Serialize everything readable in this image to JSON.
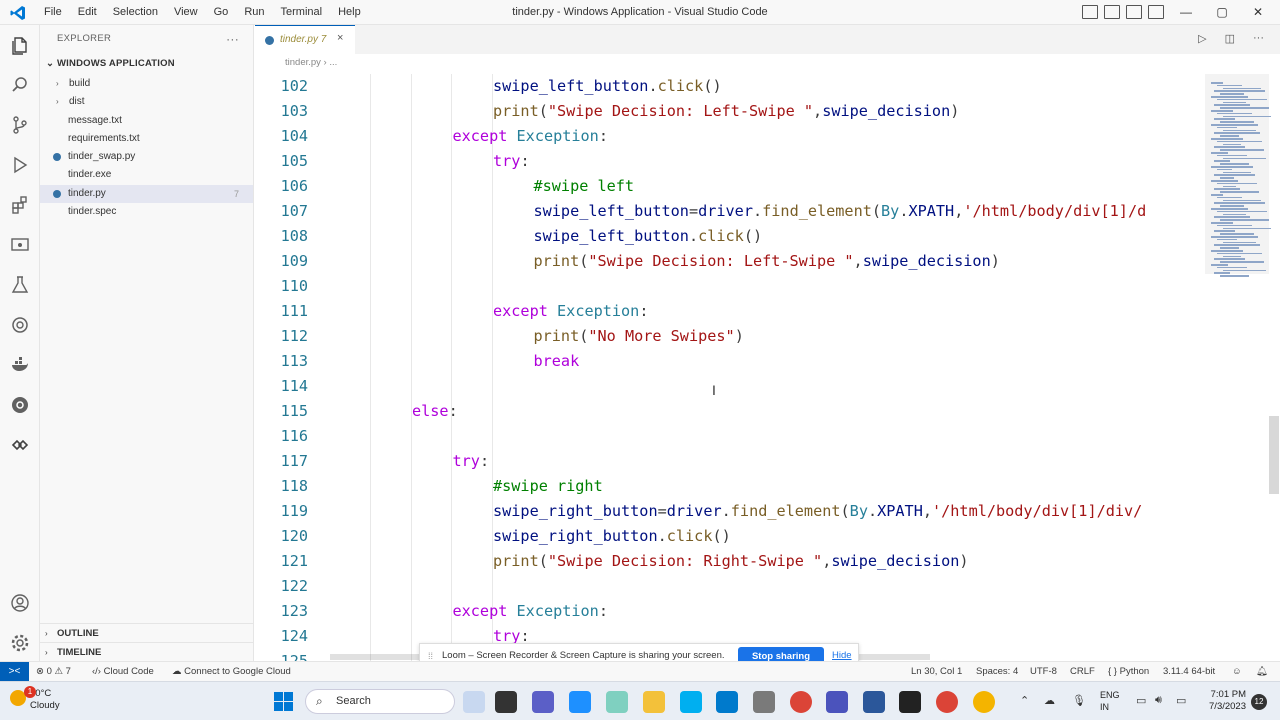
{
  "titlebar": {
    "menu": [
      "File",
      "Edit",
      "Selection",
      "View",
      "Go",
      "Run",
      "Terminal",
      "Help"
    ],
    "title": "tinder.py - Windows Application - Visual Studio Code",
    "controls": [
      "—",
      "▢",
      "✕"
    ]
  },
  "explorer": {
    "header": "EXPLORER",
    "more": "···",
    "project": "WINDOWS APPLICATION",
    "items": [
      {
        "label": "build",
        "type": "folder",
        "chev": "›"
      },
      {
        "label": "dist",
        "type": "folder",
        "chev": "›"
      },
      {
        "label": "message.txt",
        "type": "file"
      },
      {
        "label": "requirements.txt",
        "type": "file"
      },
      {
        "label": "tinder_swap.py",
        "type": "python"
      },
      {
        "label": "tinder.exe",
        "type": "file"
      },
      {
        "label": "tinder.py",
        "type": "python",
        "badge": "7",
        "selected": true
      },
      {
        "label": "tinder.spec",
        "type": "file"
      }
    ],
    "outline": "OUTLINE",
    "timeline": "TIMELINE",
    "chev": "›"
  },
  "tab": {
    "label": "tinder.py",
    "badge": "7",
    "close": "×"
  },
  "breadcrumb": "tinder.py  ›  ...",
  "editor": {
    "lines": [
      {
        "n": "102",
        "indent": 4,
        "tokens": [
          [
            "var",
            "swipe_left_button"
          ],
          [
            "p",
            "."
          ],
          [
            "fn",
            "click"
          ],
          [
            "p",
            "()"
          ]
        ]
      },
      {
        "n": "103",
        "indent": 4,
        "tokens": [
          [
            "fn",
            "print"
          ],
          [
            "p",
            "("
          ],
          [
            "str",
            "\"Swipe Decision: Left-Swipe \""
          ],
          [
            "p",
            ","
          ],
          [
            "var",
            "swipe_decision"
          ],
          [
            "p",
            ")"
          ]
        ]
      },
      {
        "n": "104",
        "indent": 3,
        "tokens": [
          [
            "kw",
            "except"
          ],
          [
            "p",
            " "
          ],
          [
            "cls",
            "Exception"
          ],
          [
            "p",
            ":"
          ]
        ]
      },
      {
        "n": "105",
        "indent": 4,
        "tokens": [
          [
            "kw",
            "try"
          ],
          [
            "p",
            ":"
          ]
        ]
      },
      {
        "n": "106",
        "indent": 5,
        "tokens": [
          [
            "cm",
            "#swipe left"
          ]
        ]
      },
      {
        "n": "107",
        "indent": 5,
        "tokens": [
          [
            "var",
            "swipe_left_button"
          ],
          [
            "p",
            "="
          ],
          [
            "var",
            "driver"
          ],
          [
            "p",
            "."
          ],
          [
            "fn",
            "find_element"
          ],
          [
            "p",
            "("
          ],
          [
            "cls",
            "By"
          ],
          [
            "p",
            "."
          ],
          [
            "var",
            "XPATH"
          ],
          [
            "p",
            ","
          ],
          [
            "str",
            "'/html/body/div[1]/d"
          ]
        ]
      },
      {
        "n": "108",
        "indent": 5,
        "tokens": [
          [
            "var",
            "swipe_left_button"
          ],
          [
            "p",
            "."
          ],
          [
            "fn",
            "click"
          ],
          [
            "p",
            "()"
          ]
        ]
      },
      {
        "n": "109",
        "indent": 5,
        "tokens": [
          [
            "fn",
            "print"
          ],
          [
            "p",
            "("
          ],
          [
            "str",
            "\"Swipe Decision: Left-Swipe \""
          ],
          [
            "p",
            ","
          ],
          [
            "var",
            "swipe_decision"
          ],
          [
            "p",
            ")"
          ]
        ]
      },
      {
        "n": "110",
        "indent": 0,
        "tokens": []
      },
      {
        "n": "111",
        "indent": 4,
        "tokens": [
          [
            "kw",
            "except"
          ],
          [
            "p",
            " "
          ],
          [
            "cls",
            "Exception"
          ],
          [
            "p",
            ":"
          ]
        ]
      },
      {
        "n": "112",
        "indent": 5,
        "tokens": [
          [
            "fn",
            "print"
          ],
          [
            "p",
            "("
          ],
          [
            "str",
            "\"No More Swipes\""
          ],
          [
            "p",
            ")"
          ]
        ]
      },
      {
        "n": "113",
        "indent": 5,
        "tokens": [
          [
            "kw",
            "break"
          ]
        ]
      },
      {
        "n": "114",
        "indent": 0,
        "tokens": []
      },
      {
        "n": "115",
        "indent": 2,
        "tokens": [
          [
            "kw",
            "else"
          ],
          [
            "p",
            ":"
          ]
        ]
      },
      {
        "n": "116",
        "indent": 0,
        "tokens": []
      },
      {
        "n": "117",
        "indent": 3,
        "tokens": [
          [
            "kw",
            "try"
          ],
          [
            "p",
            ":"
          ]
        ]
      },
      {
        "n": "118",
        "indent": 4,
        "tokens": [
          [
            "cm",
            "#swipe right"
          ]
        ]
      },
      {
        "n": "119",
        "indent": 4,
        "tokens": [
          [
            "var",
            "swipe_right_button"
          ],
          [
            "p",
            "="
          ],
          [
            "var",
            "driver"
          ],
          [
            "p",
            "."
          ],
          [
            "fn",
            "find_element"
          ],
          [
            "p",
            "("
          ],
          [
            "cls",
            "By"
          ],
          [
            "p",
            "."
          ],
          [
            "var",
            "XPATH"
          ],
          [
            "p",
            ","
          ],
          [
            "str",
            "'/html/body/div[1]/div/"
          ]
        ]
      },
      {
        "n": "120",
        "indent": 4,
        "tokens": [
          [
            "var",
            "swipe_right_button"
          ],
          [
            "p",
            "."
          ],
          [
            "fn",
            "click"
          ],
          [
            "p",
            "()"
          ]
        ]
      },
      {
        "n": "121",
        "indent": 4,
        "tokens": [
          [
            "fn",
            "print"
          ],
          [
            "p",
            "("
          ],
          [
            "str",
            "\"Swipe Decision: Right-Swipe \""
          ],
          [
            "p",
            ","
          ],
          [
            "var",
            "swipe_decision"
          ],
          [
            "p",
            ")"
          ]
        ]
      },
      {
        "n": "122",
        "indent": 0,
        "tokens": []
      },
      {
        "n": "123",
        "indent": 3,
        "tokens": [
          [
            "kw",
            "except"
          ],
          [
            "p",
            " "
          ],
          [
            "cls",
            "Exception"
          ],
          [
            "p",
            ":"
          ]
        ]
      },
      {
        "n": "124",
        "indent": 4,
        "tokens": [
          [
            "kw",
            "try"
          ],
          [
            "p",
            ":"
          ]
        ]
      },
      {
        "n": "125",
        "indent": 0,
        "tokens": []
      }
    ]
  },
  "loom": {
    "grip": "⁞⁞",
    "message": "Loom – Screen Recorder & Screen Capture is sharing your screen.",
    "stop": "Stop sharing",
    "hide": "Hide"
  },
  "statusbar": {
    "remote": "><",
    "problems": "⊗ 0  ⚠ 7",
    "cloud_code": "Cloud Code",
    "google_cloud": "Connect to Google Cloud",
    "position": "Ln 30, Col 1",
    "spaces": "Spaces: 4",
    "encoding": "UTF-8",
    "eol": "CRLF",
    "language": "Python",
    "interpreter": "3.11.4 64-bit"
  },
  "taskbar": {
    "temp": "30°C",
    "condition": "Cloudy",
    "weather_badge": "1",
    "search": "Search",
    "lang1": "ENG",
    "lang2": "IN",
    "time": "7:01 PM",
    "date": "7/3/2023",
    "notif": "12"
  },
  "colors": {
    "accent": "#005fb8",
    "keyword": "#af00db",
    "function": "#795e26",
    "string": "#a31515",
    "variable": "#001080",
    "class": "#267f99",
    "comment": "#008000"
  }
}
